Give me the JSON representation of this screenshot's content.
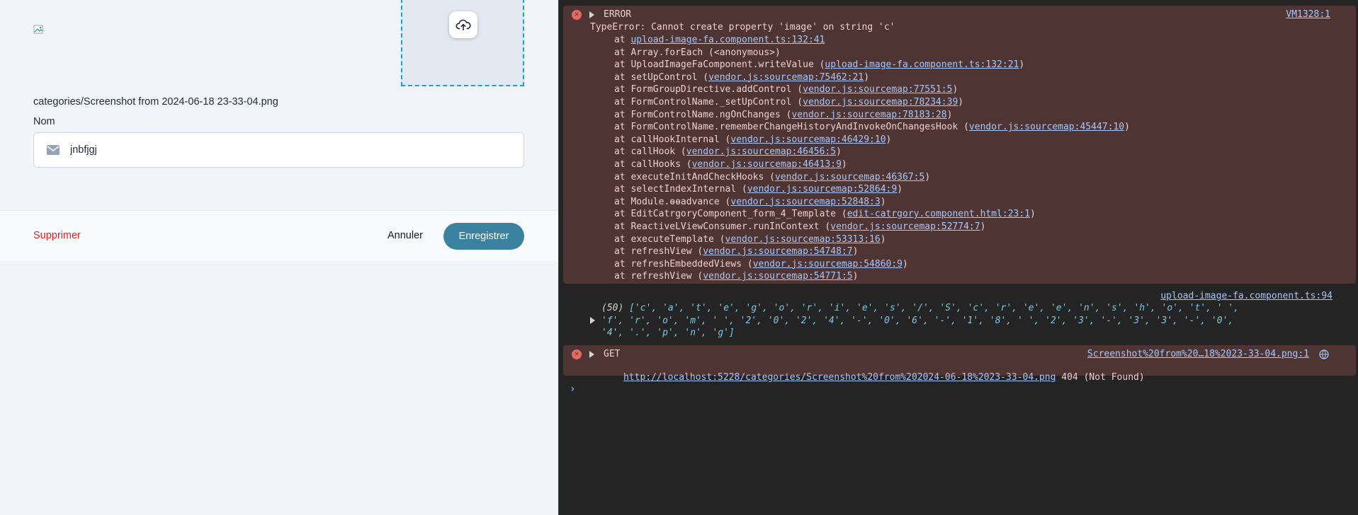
{
  "app": {
    "file_path": "categories/Screenshot from 2024-06-18 23-33-04.png",
    "name_label": "Nom",
    "name_value": "jnbfjgj",
    "delete_label": "Supprimer",
    "cancel_label": "Annuler",
    "save_label": "Enregistrer",
    "icons": {
      "upload": "cloud-upload-icon",
      "field": "envelope-icon",
      "image": "broken-image-icon"
    },
    "colors": {
      "accent": "#3b82a1",
      "danger": "#dc2626",
      "dropzone_border": "#0ea5e9"
    }
  },
  "console": {
    "error1": {
      "level": "ERROR",
      "source": "VM1328:1",
      "message": "TypeError: Cannot create property 'image' on string 'c'",
      "frames": [
        {
          "fn": "",
          "loc": "upload-image-fa.component.ts:132:41"
        },
        {
          "fn": "Array.forEach",
          "loc": "<anonymous>",
          "plain": true
        },
        {
          "fn": "UploadImageFaComponent.writeValue",
          "loc": "upload-image-fa.component.ts:132:21"
        },
        {
          "fn": "setUpControl",
          "loc": "vendor.js:sourcemap:75462:21"
        },
        {
          "fn": "FormGroupDirective.addControl",
          "loc": "vendor.js:sourcemap:77551:5"
        },
        {
          "fn": "FormControlName._setUpControl",
          "loc": "vendor.js:sourcemap:78234:39"
        },
        {
          "fn": "FormControlName.ngOnChanges",
          "loc": "vendor.js:sourcemap:78183:28"
        },
        {
          "fn": "FormControlName.rememberChangeHistoryAndInvokeOnChangesHook",
          "loc": "vendor.js:sourcemap:45447:10"
        },
        {
          "fn": "callHookInternal",
          "loc": "vendor.js:sourcemap:46429:10"
        },
        {
          "fn": "callHook",
          "loc": "vendor.js:sourcemap:46456:5"
        },
        {
          "fn": "callHooks",
          "loc": "vendor.js:sourcemap:46413:9"
        },
        {
          "fn": "executeInitAndCheckHooks",
          "loc": "vendor.js:sourcemap:46367:5"
        },
        {
          "fn": "selectIndexInternal",
          "loc": "vendor.js:sourcemap:52864:9"
        },
        {
          "fn": "Module.ɵɵadvance",
          "loc": "vendor.js:sourcemap:52848:3"
        },
        {
          "fn": "EditCatrgoryComponent_form_4_Template",
          "loc": "edit-catrgory.component.html:23:1"
        },
        {
          "fn": "ReactiveLViewConsumer.runInContext",
          "loc": "vendor.js:sourcemap:52774:7"
        },
        {
          "fn": "executeTemplate",
          "loc": "vendor.js:sourcemap:53313:16"
        },
        {
          "fn": "refreshView",
          "loc": "vendor.js:sourcemap:54748:7"
        },
        {
          "fn": "refreshEmbeddedViews",
          "loc": "vendor.js:sourcemap:54860:9"
        },
        {
          "fn": "refreshView",
          "loc": "vendor.js:sourcemap:54771:5"
        }
      ]
    },
    "log": {
      "source": "upload-image-fa.component.ts:94",
      "count": "(50)",
      "chars_line1": [
        "c",
        "a",
        "t",
        "e",
        "g",
        "o",
        "r",
        "i",
        "e",
        "s",
        "/",
        "S",
        "c",
        "r",
        "e",
        "e",
        "n",
        "s",
        "h",
        "o",
        "t",
        " "
      ],
      "chars_line2": [
        "f",
        "r",
        "o",
        "m",
        " ",
        "2",
        "0",
        "2",
        "4",
        "-",
        "0",
        "6",
        "-",
        "1",
        "8",
        " ",
        "2",
        "3",
        "-",
        "3",
        "3",
        "-",
        "0"
      ],
      "chars_line3": [
        "4",
        ".",
        "p",
        "n",
        "g"
      ]
    },
    "error2": {
      "method": "GET",
      "source": "Screenshot%20from%20…18%2023-33-04.png:1",
      "url": "http://localhost:5228/categories/Screenshot%20from%202024-06-18%2023-33-04.png",
      "status": "404 (Not Found)"
    },
    "prompt": "›"
  }
}
